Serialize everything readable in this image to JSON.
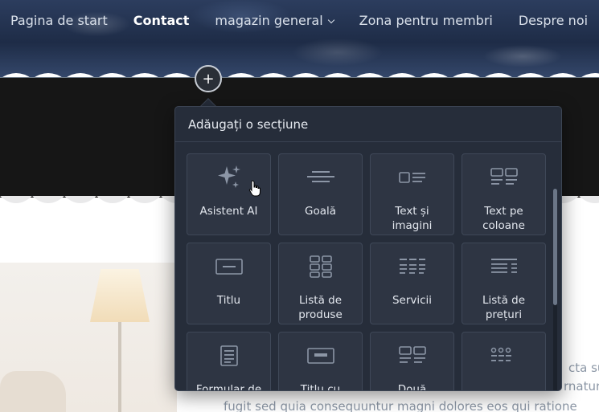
{
  "nav": {
    "items": [
      {
        "label": "Pagina de start"
      },
      {
        "label": "Contact"
      },
      {
        "label": "magazin general"
      },
      {
        "label": "Zona pentru membri"
      },
      {
        "label": "Despre noi"
      }
    ]
  },
  "add_button": {
    "icon": "plus-icon",
    "glyph": "+"
  },
  "panel": {
    "title": "Adăugați o secțiune",
    "tiles": [
      {
        "label": "Asistent AI",
        "icon": "sparkles-icon"
      },
      {
        "label": "Goală",
        "icon": "blank-lines-icon"
      },
      {
        "label": "Text și imagini",
        "icon": "text-image-icon"
      },
      {
        "label": "Text pe coloane",
        "icon": "columns-icon"
      },
      {
        "label": "Titlu",
        "icon": "title-icon"
      },
      {
        "label": "Listă de produse",
        "icon": "product-grid-icon"
      },
      {
        "label": "Servicii",
        "icon": "services-icon"
      },
      {
        "label": "Listă de prețuri",
        "icon": "price-list-icon"
      },
      {
        "label": "Formular de",
        "icon": "form-icon"
      },
      {
        "label": "Titlu cu",
        "icon": "title-banner-icon"
      },
      {
        "label": "Două",
        "icon": "two-columns-icon"
      },
      {
        "label": "",
        "icon": "dots-grid-icon"
      }
    ]
  },
  "page_text": {
    "line1": "cta su",
    "line2": "rnatur",
    "line3": "fugit sed quia consequuntur magni dolores eos qui ratione"
  }
}
